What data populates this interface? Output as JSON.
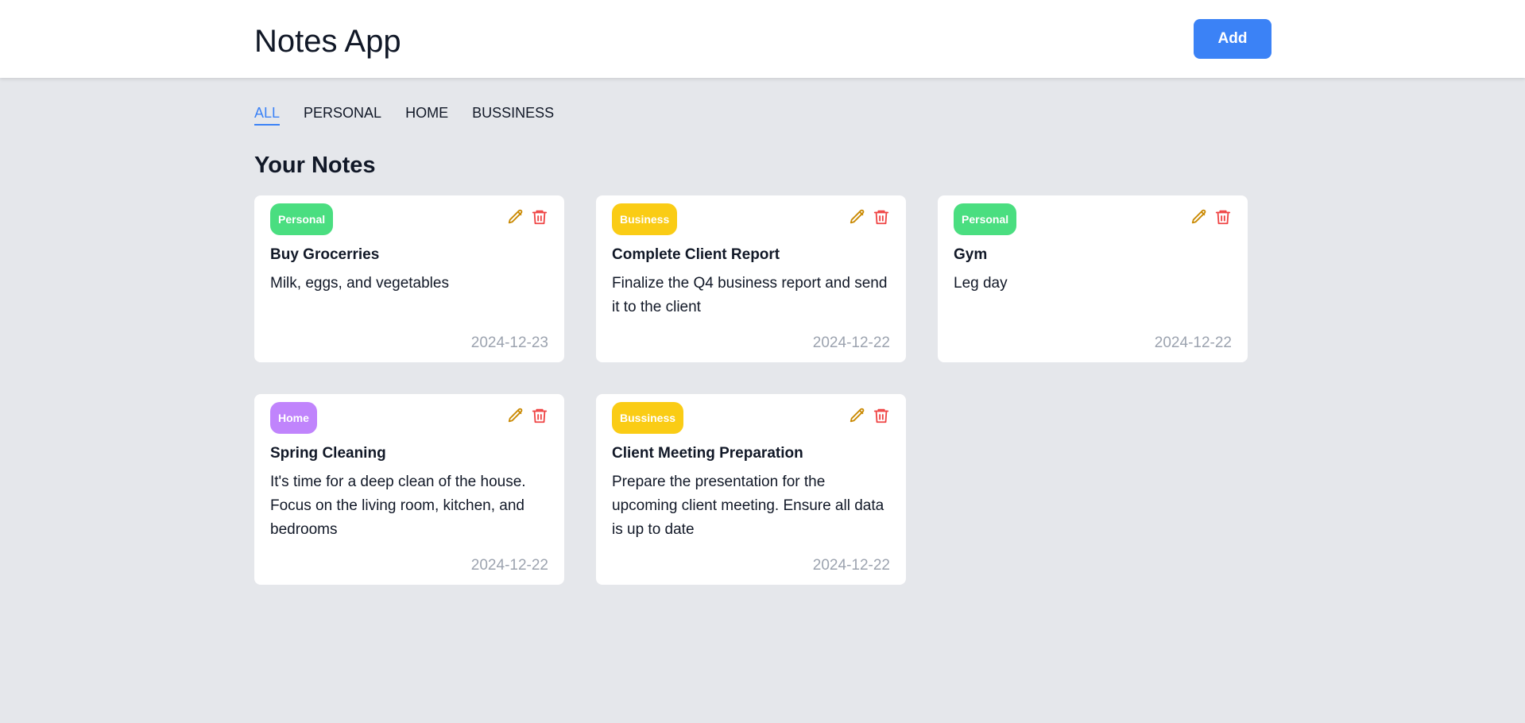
{
  "header": {
    "title": "Notes App",
    "add_label": "Add"
  },
  "tabs": [
    {
      "label": "ALL",
      "active": true
    },
    {
      "label": "PERSONAL",
      "active": false
    },
    {
      "label": "HOME",
      "active": false
    },
    {
      "label": "BUSSINESS",
      "active": false
    }
  ],
  "section_title": "Your Notes",
  "colors": {
    "accent": "#3b82f6",
    "personal": "#4ade80",
    "business": "#facc15",
    "home": "#c084fc",
    "edit_icon": "#ca8a04",
    "delete_icon": "#ef4444",
    "date_text": "#9ca3af"
  },
  "notes": [
    {
      "category": "Personal",
      "title": "Buy Grocerries",
      "body": "Milk, eggs, and vegetables",
      "date": "2024-12-23"
    },
    {
      "category": "Business",
      "title": "Complete Client Report",
      "body": "Finalize the Q4 business report and send it to the client",
      "date": "2024-12-22"
    },
    {
      "category": "Personal",
      "title": "Gym",
      "body": "Leg day",
      "date": "2024-12-22"
    },
    {
      "category": "Home",
      "title": "Spring Cleaning",
      "body": "It's time for a deep clean of the house. Focus on the living room, kitchen, and bedrooms",
      "date": "2024-12-22"
    },
    {
      "category": "Bussiness",
      "title": "Client Meeting Preparation",
      "body": "Prepare the presentation for the upcoming client meeting. Ensure all data is up to date",
      "date": "2024-12-22"
    }
  ],
  "icons": {
    "edit": "pencil-icon",
    "delete": "trash-icon"
  }
}
